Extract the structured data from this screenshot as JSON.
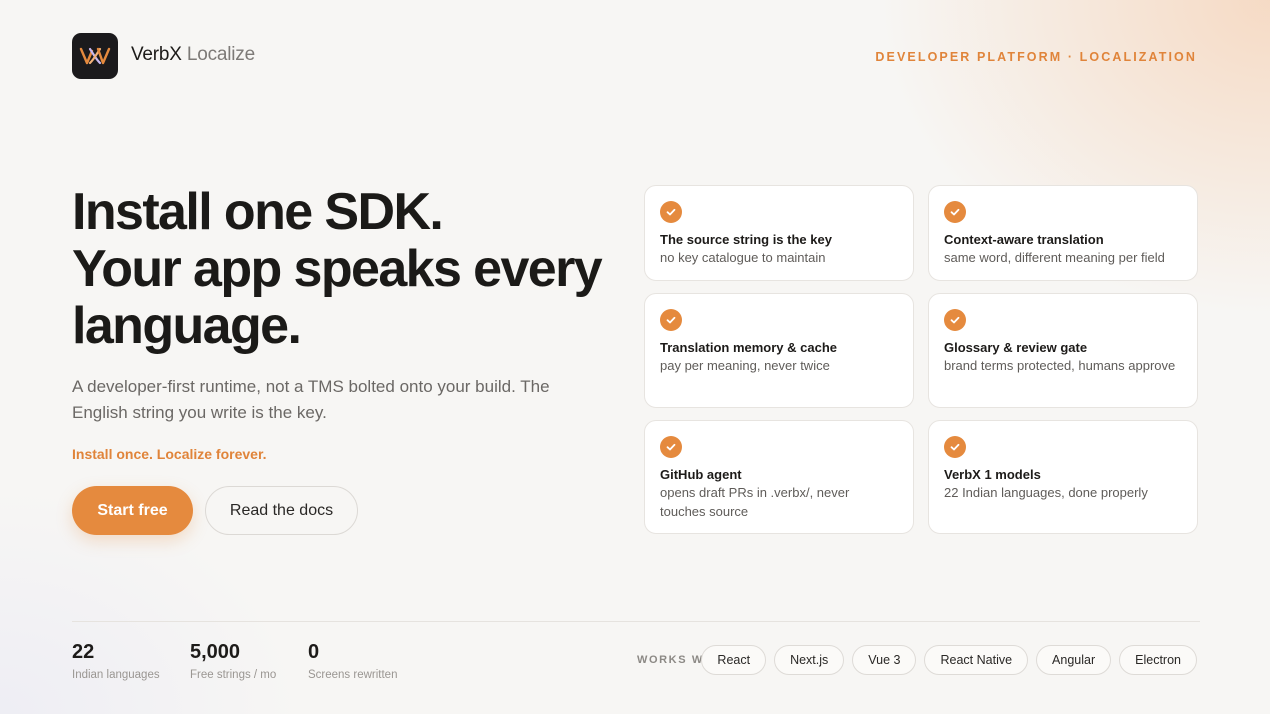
{
  "header": {
    "brand_primary": "VerbX",
    "brand_secondary": "Localize",
    "logo_icon": "verbx-logo-icon",
    "eyebrow": "DEVELOPER PLATFORM · LOCALIZATION"
  },
  "hero": {
    "headline_line1": "Install one SDK.",
    "headline_line2": "Your app speaks every",
    "headline_line3": "language.",
    "subcopy": "A developer-first runtime, not a TMS bolted onto your build. The English string you write is the key.",
    "tagline": "Install once. Localize forever.",
    "primary_cta": "Start free",
    "secondary_cta": "Read the docs"
  },
  "features": [
    {
      "title": "The source string is the key",
      "desc": "no key catalogue to maintain",
      "icon": "check-icon"
    },
    {
      "title": "Context-aware translation",
      "desc": "same word, different meaning per field",
      "icon": "check-icon"
    },
    {
      "title": "Translation memory & cache",
      "desc": "pay per meaning, never twice",
      "icon": "check-icon"
    },
    {
      "title": "Glossary & review gate",
      "desc": "brand terms protected, humans approve",
      "icon": "check-icon"
    },
    {
      "title": "GitHub agent",
      "desc": "opens draft PRs in .verbx/, never touches source",
      "icon": "check-icon"
    },
    {
      "title": "VerbX 1 models",
      "desc": "22 Indian languages, done properly",
      "icon": "check-icon"
    }
  ],
  "stats": [
    {
      "value": "22",
      "label": "Indian languages"
    },
    {
      "value": "5,000",
      "label": "Free strings / mo"
    },
    {
      "value": "0",
      "label": "Screens rewritten"
    }
  ],
  "works_with": {
    "label": "WORKS WITH",
    "frameworks": [
      "React",
      "Next.js",
      "Vue 3",
      "React Native",
      "Angular",
      "Electron"
    ]
  },
  "colors": {
    "accent": "#e58a3e",
    "text": "#1d1b19",
    "muted": "#6b6865",
    "background": "#f7f6f4"
  }
}
